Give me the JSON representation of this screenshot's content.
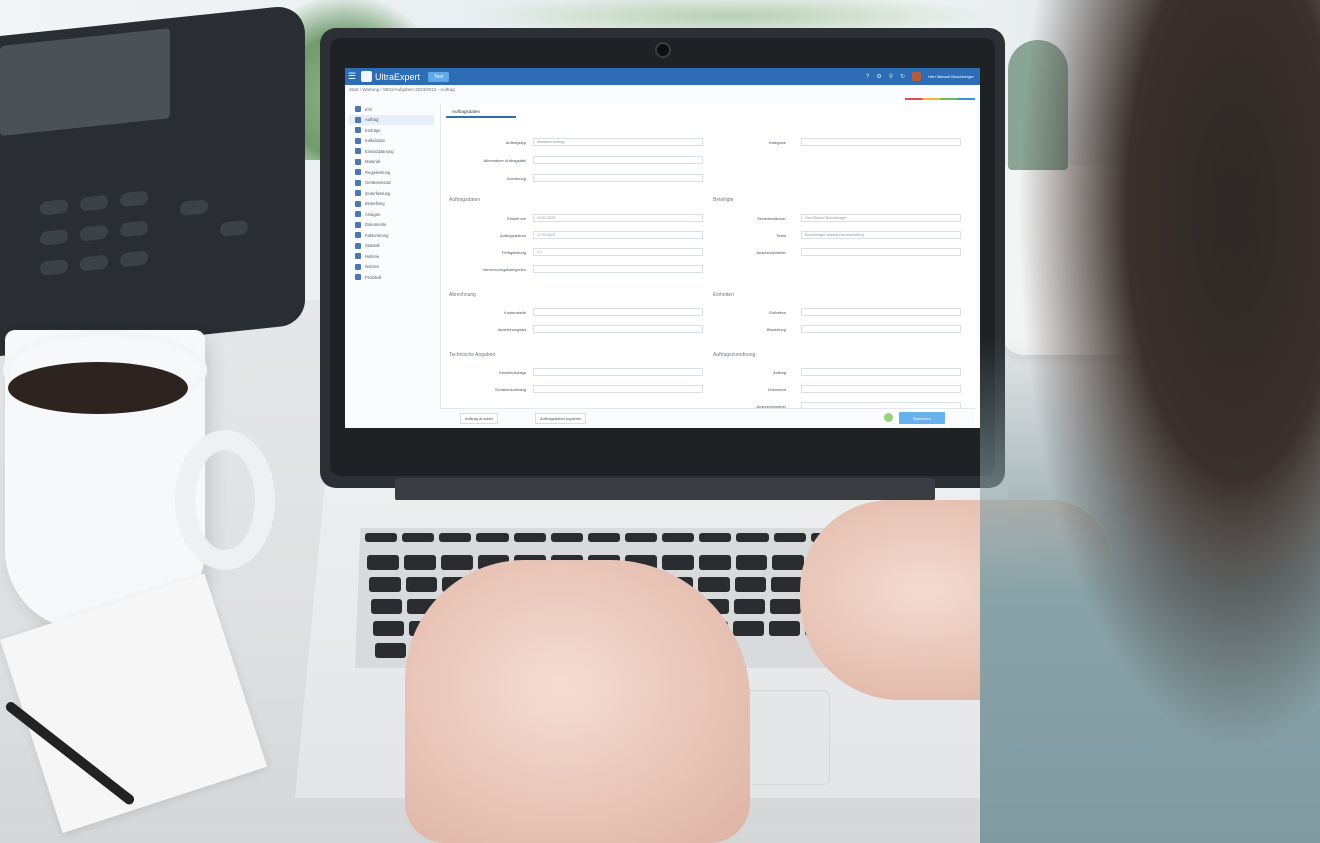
{
  "app": {
    "brand": "UltraExpert",
    "environment_badge": "Test",
    "breadcrumb": "Start / Wartung / WKD/Aufgaben 2023/0012 - Auftrag",
    "user": "Herr Manuel Buschberger",
    "active_tab": "Auftragsdaten"
  },
  "sidebar": {
    "items": [
      {
        "label": "Info",
        "icon": "info-icon"
      },
      {
        "label": "Auftrag",
        "icon": "document-icon"
      },
      {
        "label": "Einträge",
        "icon": "list-icon"
      },
      {
        "label": "Kalkulation",
        "icon": "calculator-icon"
      },
      {
        "label": "Einsatzplanung",
        "icon": "calendar-icon"
      },
      {
        "label": "Material",
        "icon": "box-icon"
      },
      {
        "label": "Regieleistung",
        "icon": "wrench-icon"
      },
      {
        "label": "Geräteeinsatz",
        "icon": "truck-icon"
      },
      {
        "label": "Zeiterfassung",
        "icon": "clock-icon"
      },
      {
        "label": "Bestellung",
        "icon": "cart-icon"
      },
      {
        "label": "Anlagen",
        "icon": "attachment-icon"
      },
      {
        "label": "Dokumente",
        "icon": "folder-icon"
      },
      {
        "label": "Fakturierung",
        "icon": "invoice-icon"
      },
      {
        "label": "Statistik",
        "icon": "chart-icon"
      },
      {
        "label": "Historie",
        "icon": "history-icon"
      },
      {
        "label": "Notizen",
        "icon": "note-icon"
      },
      {
        "label": "Protokoll",
        "icon": "log-icon"
      }
    ]
  },
  "form": {
    "rows": [
      {
        "label": "Auftragstyp",
        "value": "Standard-Auftrag"
      },
      {
        "label": "Alternativer Auftragstitel",
        "value": ""
      },
      {
        "label": "Zuordnung",
        "value": ""
      }
    ],
    "right_rows": [
      {
        "label": "Kategorie",
        "value": ""
      }
    ],
    "sections": [
      {
        "title": "Auftragsdaten"
      },
      {
        "title": "Beteiligte"
      },
      {
        "title": "Abrechnung"
      },
      {
        "title": "Einheiten"
      },
      {
        "title": "Technische Angaben"
      },
      {
        "title": "Auftragszuordnung"
      }
    ],
    "section_a_fields": [
      "Erstellt am",
      "Auftragsdatum",
      "Fertigstellung",
      "Verrechnungskategorien"
    ],
    "section_a_values": [
      "12.01.2023",
      "17.03.2023",
      "2.1",
      ""
    ],
    "section_b_fields": [
      "Verantwortlicher",
      "Team",
      "Ansprechpartner"
    ],
    "section_b_values": [
      "Herr Manuel Buschberger",
      "Buschberger Manuel (Verantwortlich)",
      ""
    ],
    "section_c_fields": [
      "Kostenstelle",
      "Abrechnungsart"
    ],
    "section_d_fields": [
      "Einheiten",
      "Bewertung"
    ],
    "section_e_fields": [
      "Gewerk/Anlage",
      "Schadensumfang"
    ],
    "section_f_fields": [
      "Auftrag",
      "Dokument",
      "Ansprechpartner"
    ]
  },
  "footer": {
    "back_label": "Auftrag drucken",
    "alt_label": "Auftragsdaten kopieren",
    "save_label": "Speichern"
  },
  "colors": {
    "topbar": "#2d6db5",
    "save_button": "#67b0ee"
  }
}
